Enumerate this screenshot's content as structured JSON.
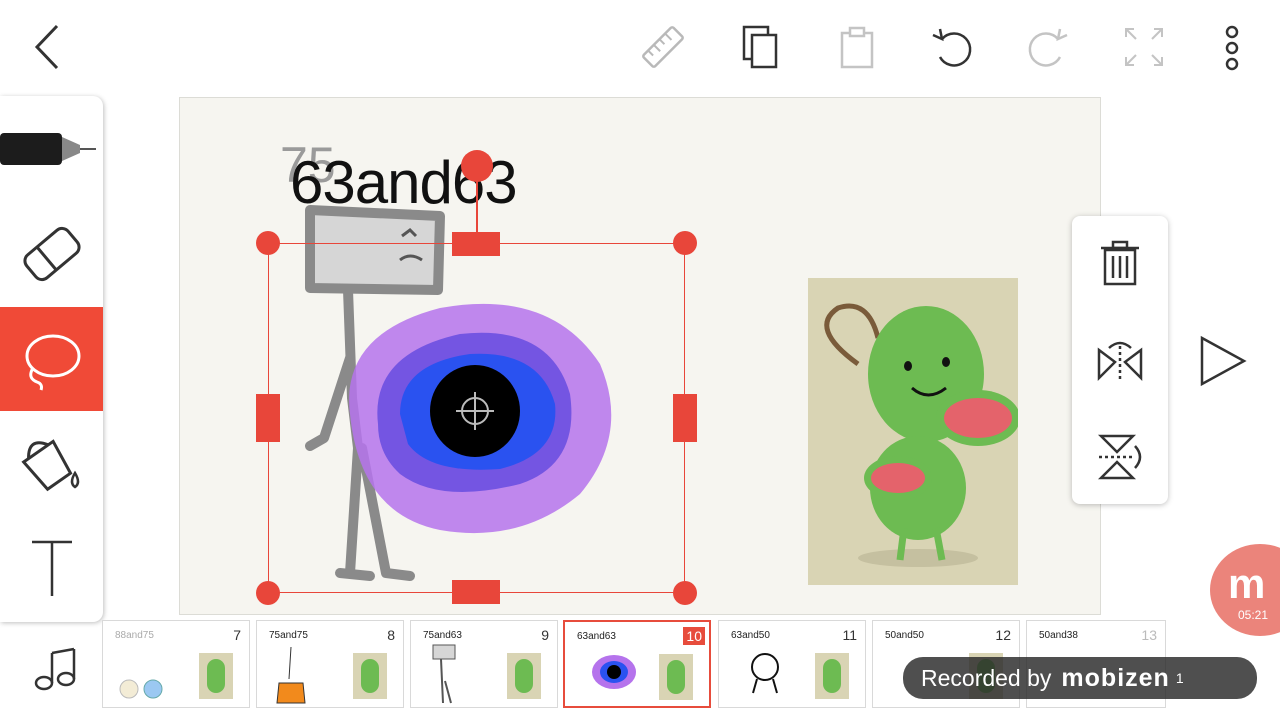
{
  "toolbar": {
    "icons": [
      "back-icon",
      "ruler-icon",
      "copy-icon",
      "paste-icon",
      "undo-icon",
      "redo-icon",
      "fullscreen-icon",
      "more-icon"
    ]
  },
  "canvas": {
    "title_text": "63and63",
    "ghost_text": "75"
  },
  "context_menu": {
    "items": [
      "trash-icon",
      "flip-horizontal-icon",
      "flip-vertical-icon"
    ]
  },
  "timeline": {
    "frames": [
      {
        "label": "88and75",
        "number": "7"
      },
      {
        "label": "75and75",
        "number": "8"
      },
      {
        "label": "75and63",
        "number": "9"
      },
      {
        "label": "63and63",
        "number": "10"
      },
      {
        "label": "63and50",
        "number": "11"
      },
      {
        "label": "50and50",
        "number": "12"
      },
      {
        "label": "50and38",
        "number": "13"
      }
    ],
    "current_frame": "10",
    "partial_number": "1"
  },
  "recorder": {
    "time": "05:21",
    "badge_text": "Recorded by",
    "brand": "mobizen"
  },
  "colors": {
    "accent": "#e8463a",
    "purple": "#b573ec",
    "blue": "#2a52f0",
    "green": "#6dbb52"
  }
}
